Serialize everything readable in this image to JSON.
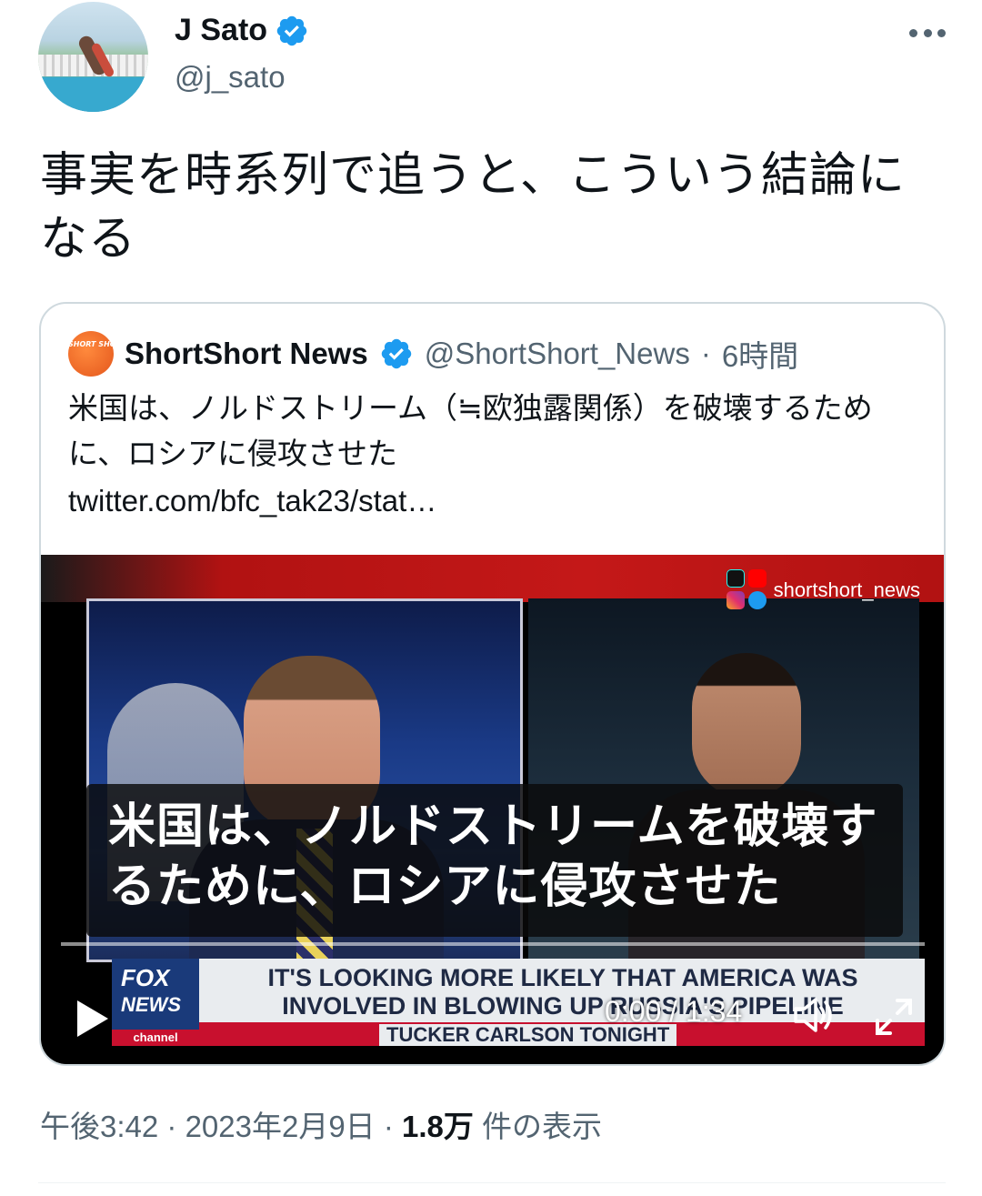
{
  "author": {
    "display_name": "J Sato",
    "handle": "@j_sato",
    "verified": true
  },
  "tweet": {
    "text": "事実を時系列で追うと、こういう結論になる"
  },
  "quoted_tweet": {
    "display_name": "ShortShort News",
    "handle": "@ShortShort_News",
    "separator": "·",
    "time_ago": "6時間",
    "avatar_text": "SHORT SHORT NEWS",
    "text": "米国は、ノルドストリーム（≒欧独露関係）を破壊するために、ロシアに侵攻させた",
    "link": "twitter.com/bfc_tak23/stat…",
    "video": {
      "watermark": "shortshort_news",
      "caption": "米国は、ノルドストリームを破壊するために、ロシアに侵攻させた",
      "chyron_logo_line1": "FOX",
      "chyron_logo_line2": "NEWS",
      "chyron_logo_line3": "channel",
      "chyron_text": "IT'S LOOKING MORE LIKELY THAT AMERICA WAS INVOLVED IN BLOWING UP RUSSIA'S PIPELINE",
      "chyron_show": "TUCKER CARLSON TONIGHT",
      "time_display": "0:00 / 1:34",
      "progress": 0
    }
  },
  "meta": {
    "time": "午後3:42",
    "sep1": " · ",
    "date": "2023年2月9日",
    "sep2": " · ",
    "views_count": "1.8万",
    "views_label": " 件の表示"
  },
  "colors": {
    "verified": "#1d9bf0",
    "secondary_text": "#536471",
    "primary_text": "#0f1419",
    "border": "#cfd9de"
  },
  "icons": {
    "verified": "verified-badge-icon",
    "more": "more-dots-icon",
    "play": "play-icon",
    "volume": "volume-icon",
    "fullscreen": "fullscreen-icon"
  }
}
